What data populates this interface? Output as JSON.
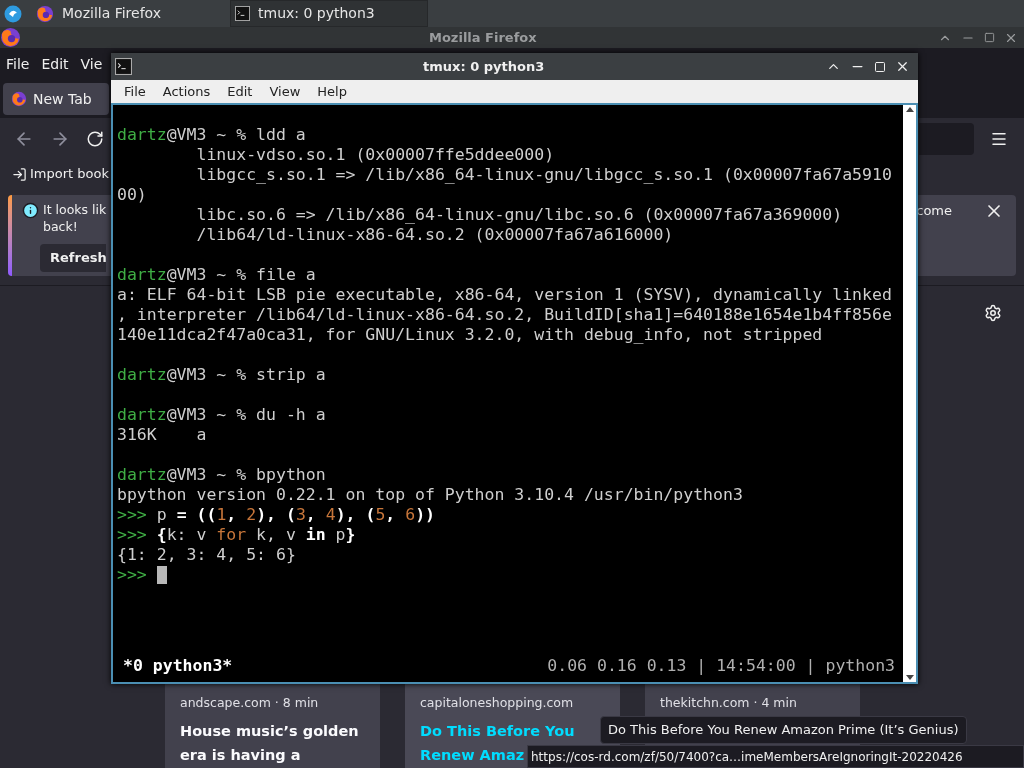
{
  "taskbar": {
    "tasks": [
      {
        "label": "Mozilla Firefox",
        "kind": "browser",
        "selected": false
      },
      {
        "label": "tmux: 0 python3",
        "kind": "terminal",
        "selected": true
      }
    ]
  },
  "firefox": {
    "title": "Mozilla Firefox",
    "menu": [
      "File",
      "Edit",
      "Vie"
    ],
    "tabs": [
      {
        "label": "New Tab",
        "selected": true
      }
    ],
    "bookmarks": [
      "Import book"
    ],
    "notification": {
      "lines": [
        "It looks lik",
        "back!"
      ],
      "button": "Refresh",
      "text_right": "come"
    },
    "cards": [
      {
        "source": "andscape.com · 8 min",
        "title_lines": [
          "House music’s golden",
          "era is having a"
        ],
        "hovered": false
      },
      {
        "source": "capitaloneshopping.com",
        "title_lines": [
          "Do This Before You",
          "Renew Amaz"
        ],
        "hovered": true
      },
      {
        "source": "thekitchn.com · 4 min"
      }
    ],
    "tooltip": "Do This Before You Renew Amazon Prime (It’s Genius)",
    "status_url": "https://cos-rd.com/zf/50/7400?ca…imeMembersAreIgnoringIt-20220426"
  },
  "terminal": {
    "title": "tmux: 0 python3",
    "menu": [
      "File",
      "Actions",
      "Edit",
      "View",
      "Help"
    ],
    "blocks": [
      {
        "lines": [
          {
            "segments": [
              {
                "text": "dartz",
                "kind": "user"
              },
              {
                "text": "@VM3 ~ % ldd a",
                "kind": "plain"
              }
            ]
          },
          {
            "segments": [
              {
                "text": "        linux-vdso.so.1 (0x00007ffe5ddee000)",
                "kind": "plain"
              }
            ]
          },
          {
            "segments": [
              {
                "text": "        libgcc_s.so.1 => /lib/x86_64-linux-gnu/libgcc_s.so.1 (0x00007fa67a5910",
                "kind": "plain"
              }
            ]
          },
          {
            "segments": [
              {
                "text": "00)",
                "kind": "plain"
              }
            ]
          },
          {
            "segments": [
              {
                "text": "        libc.so.6 => /lib/x86_64-linux-gnu/libc.so.6 (0x00007fa67a369000)",
                "kind": "plain"
              }
            ]
          },
          {
            "segments": [
              {
                "text": "        /lib64/ld-linux-x86-64.so.2 (0x00007fa67a616000)",
                "kind": "plain"
              }
            ]
          }
        ]
      },
      {
        "lines": [
          {
            "segments": [
              {
                "text": "dartz",
                "kind": "user"
              },
              {
                "text": "@VM3 ~ % file a",
                "kind": "plain"
              }
            ]
          },
          {
            "segments": [
              {
                "text": "a: ELF 64-bit LSB pie executable, x86-64, version 1 (SYSV), dynamically linked",
                "kind": "plain"
              }
            ]
          },
          {
            "segments": [
              {
                "text": ", interpreter /lib64/ld-linux-x86-64.so.2, BuildID[sha1]=640188e1654e1b4ff856e",
                "kind": "plain"
              }
            ]
          },
          {
            "segments": [
              {
                "text": "140e11dca2f47a0ca31, for GNU/Linux 3.2.0, with debug_info, not stripped",
                "kind": "plain"
              }
            ]
          }
        ]
      },
      {
        "lines": [
          {
            "segments": [
              {
                "text": "dartz",
                "kind": "user"
              },
              {
                "text": "@VM3 ~ % strip a",
                "kind": "plain"
              }
            ]
          }
        ]
      },
      {
        "lines": [
          {
            "segments": [
              {
                "text": "dartz",
                "kind": "user"
              },
              {
                "text": "@VM3 ~ % du -h a",
                "kind": "plain"
              }
            ]
          },
          {
            "segments": [
              {
                "text": "316K    a",
                "kind": "plain"
              }
            ]
          }
        ]
      },
      {
        "lines": [
          {
            "segments": [
              {
                "text": "dartz",
                "kind": "user"
              },
              {
                "text": "@VM3 ~ % bpython",
                "kind": "plain"
              }
            ]
          },
          {
            "segments": [
              {
                "text": "bpython version 0.22.1 on top of Python 3.10.4 /usr/bin/python3",
                "kind": "plain"
              }
            ]
          },
          {
            "segments": [
              {
                "text": ">>>",
                "kind": "user"
              },
              {
                "text": " p ",
                "kind": "plain"
              },
              {
                "text": "= ((",
                "kind": "bold"
              },
              {
                "text": "1",
                "kind": "number"
              },
              {
                "text": ", ",
                "kind": "bold"
              },
              {
                "text": "2",
                "kind": "number"
              },
              {
                "text": "), (",
                "kind": "bold"
              },
              {
                "text": "3",
                "kind": "number"
              },
              {
                "text": ", ",
                "kind": "bold"
              },
              {
                "text": "4",
                "kind": "number"
              },
              {
                "text": "), (",
                "kind": "bold"
              },
              {
                "text": "5",
                "kind": "number"
              },
              {
                "text": ", ",
                "kind": "bold"
              },
              {
                "text": "6",
                "kind": "number"
              },
              {
                "text": "))",
                "kind": "bold"
              }
            ]
          },
          {
            "segments": [
              {
                "text": ">>>",
                "kind": "user"
              },
              {
                "text": " {",
                "kind": "bold"
              },
              {
                "text": "k: v ",
                "kind": "plain"
              },
              {
                "text": "for",
                "kind": "keyword"
              },
              {
                "text": " k, v ",
                "kind": "plain"
              },
              {
                "text": "in",
                "kind": "bold"
              },
              {
                "text": " p",
                "kind": "plain"
              },
              {
                "text": "}",
                "kind": "bold"
              }
            ]
          },
          {
            "segments": [
              {
                "text": "{1: 2, 3: 4, 5: 6}",
                "kind": "plain"
              }
            ]
          },
          {
            "segments": [
              {
                "text": ">>>",
                "kind": "user"
              },
              {
                "kind": "cursor"
              }
            ]
          }
        ]
      }
    ],
    "status": {
      "left": "*0 python3*",
      "right": "0.06 0.16 0.13 | 14:54:00 | python3"
    }
  }
}
